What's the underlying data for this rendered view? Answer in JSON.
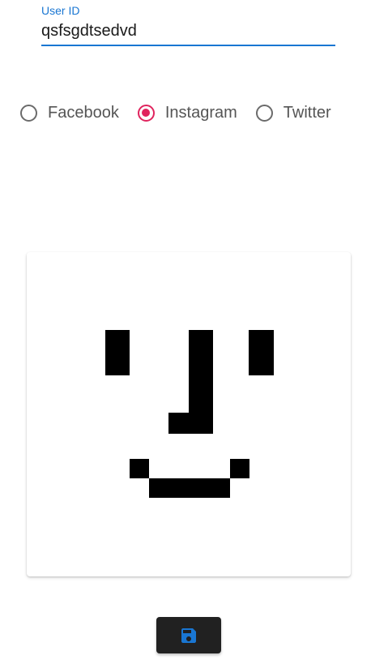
{
  "user_field": {
    "label": "User ID",
    "value": "qsfsgdtsedvd"
  },
  "platforms": {
    "selected": "Instagram",
    "options": [
      {
        "label": "Facebook",
        "checked": false
      },
      {
        "label": "Instagram",
        "checked": true
      },
      {
        "label": "Twitter",
        "checked": false
      }
    ]
  },
  "colors": {
    "accent": "#1976d2",
    "radio_selected": "#e0245e",
    "button_background": "#212121",
    "button_icon": "#1976d2"
  },
  "drawing_canvas": {
    "content": "black pixel-art face drawing"
  },
  "save_button": {
    "icon": "floppy-disk-save-icon"
  }
}
